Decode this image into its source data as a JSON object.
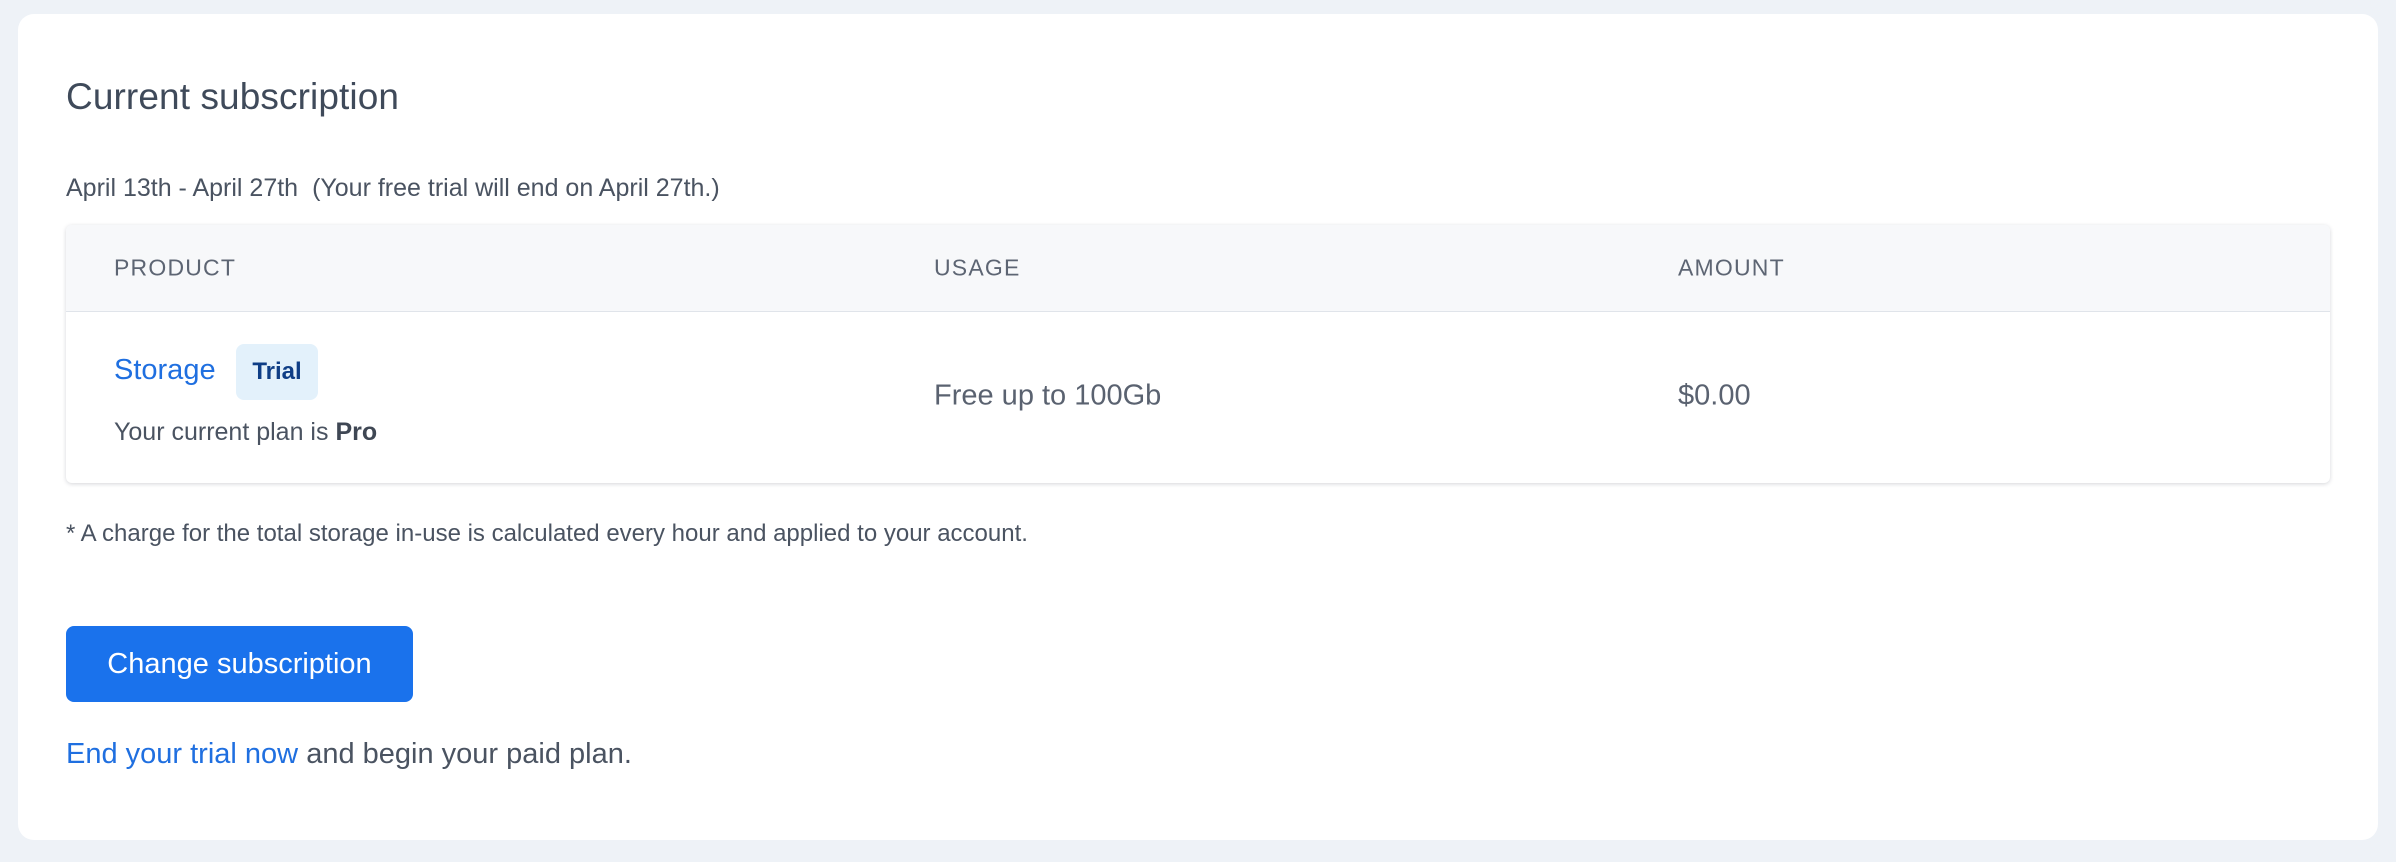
{
  "page": {
    "title": "Current subscription",
    "period": "April 13th - April 27th",
    "trial_note": "(Your free trial will end on April 27th.)"
  },
  "table": {
    "headers": {
      "product": "PRODUCT",
      "usage": "USAGE",
      "amount": "AMOUNT"
    },
    "rows": [
      {
        "product": "Storage",
        "badge": "Trial",
        "plan_prefix": "Your current plan is",
        "plan_name": "Pro",
        "usage": "Free up to 100Gb",
        "amount": "$0.00"
      }
    ]
  },
  "footnote": "* A charge for the total storage in-use is calculated every hour and applied to your account.",
  "actions": {
    "change_button": "Change subscription",
    "end_trial_link": "End your trial now",
    "end_trial_suffix": "and begin your paid plan."
  },
  "colors": {
    "accent": "#1a72ec",
    "link": "#1f6fe0",
    "badge_bg": "#e3f1fb",
    "badge_text": "#0f3e86",
    "page_bg": "#eef2f7"
  }
}
